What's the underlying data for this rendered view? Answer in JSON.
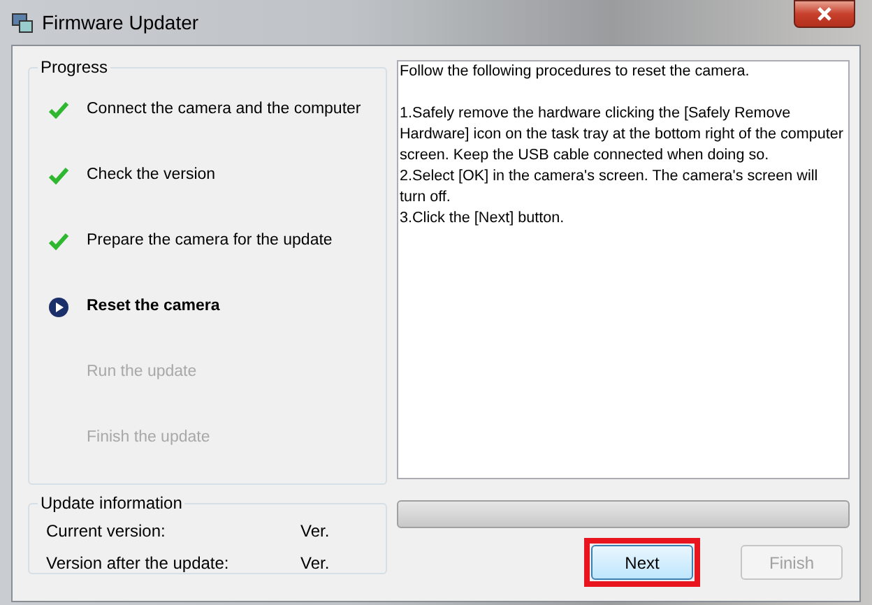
{
  "window": {
    "title": "Firmware Updater"
  },
  "progress": {
    "title": "Progress",
    "steps": [
      {
        "label": "Connect the camera and the computer",
        "kind": "done"
      },
      {
        "label": "Check the version",
        "kind": "done"
      },
      {
        "label": "Prepare the camera for the update",
        "kind": "done"
      },
      {
        "label": "Reset the camera",
        "kind": "current"
      },
      {
        "label": "Run the update",
        "kind": "pending"
      },
      {
        "label": "Finish the update",
        "kind": "pending"
      }
    ]
  },
  "instructions": [
    "Follow the following procedures to reset the camera.",
    "1.Safely remove the hardware clicking the [Safely Remove Hardware] icon on the task tray at the bottom right of the computer screen. Keep the USB cable connected when doing so.",
    "2.Select [OK] in the camera's screen. The camera's screen will turn off.",
    "3.Click the [Next] button."
  ],
  "update_information": {
    "title": "Update information",
    "rows": [
      {
        "label": "Current version:",
        "value": "Ver."
      },
      {
        "label": "Version after the update:",
        "value": "Ver."
      }
    ]
  },
  "progress_bar": {
    "level": 0
  },
  "buttons": [
    {
      "label": "Next",
      "disabled": false,
      "highlighted": true
    },
    {
      "label": "Finish",
      "disabled": true,
      "highlighted": false
    }
  ]
}
